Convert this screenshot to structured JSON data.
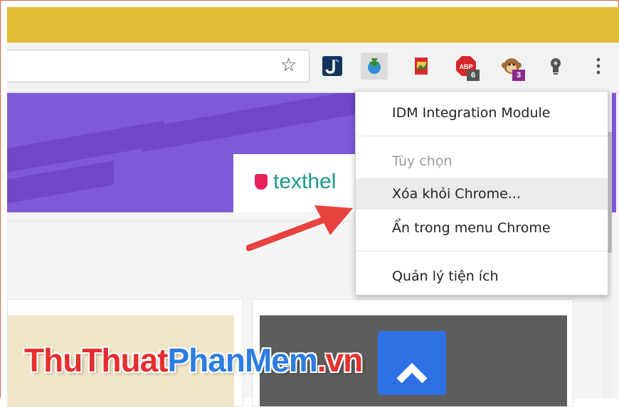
{
  "colors": {
    "title_bar": "#e2bd36",
    "banner": "#7f5ad8",
    "texthelp_teal": "#1a9a8c",
    "arrow_red": "#e8423f",
    "watermark_red": "#e62e2e",
    "watermark_blue": "#2d7de0"
  },
  "toolbar": {
    "bookmark_icon": "star-icon",
    "extensions": [
      {
        "name": "j-extension",
        "icon": "j-icon"
      },
      {
        "name": "idm-integration",
        "icon": "idm-globe-icon",
        "active": true
      },
      {
        "name": "photo-extension",
        "icon": "photo-icon"
      },
      {
        "name": "adblock",
        "icon": "abp-icon",
        "badge": "6"
      },
      {
        "name": "monkey-extension",
        "icon": "monkey-icon",
        "badge": "3"
      },
      {
        "name": "bulb-extension",
        "icon": "lightbulb-icon"
      }
    ],
    "menu_icon": "kebab-menu-icon"
  },
  "page": {
    "texthelp_logo": "texthel"
  },
  "context_menu": {
    "title": "IDM Integration Module",
    "options": "Tùy chọn",
    "remove": "Xóa khỏi Chrome...",
    "hide": "Ẩn trong menu Chrome",
    "manage": "Quản lý tiện ích"
  },
  "watermark": {
    "part1": "ThuThuat",
    "part2": "PhanMem",
    "part3": ".vn"
  }
}
